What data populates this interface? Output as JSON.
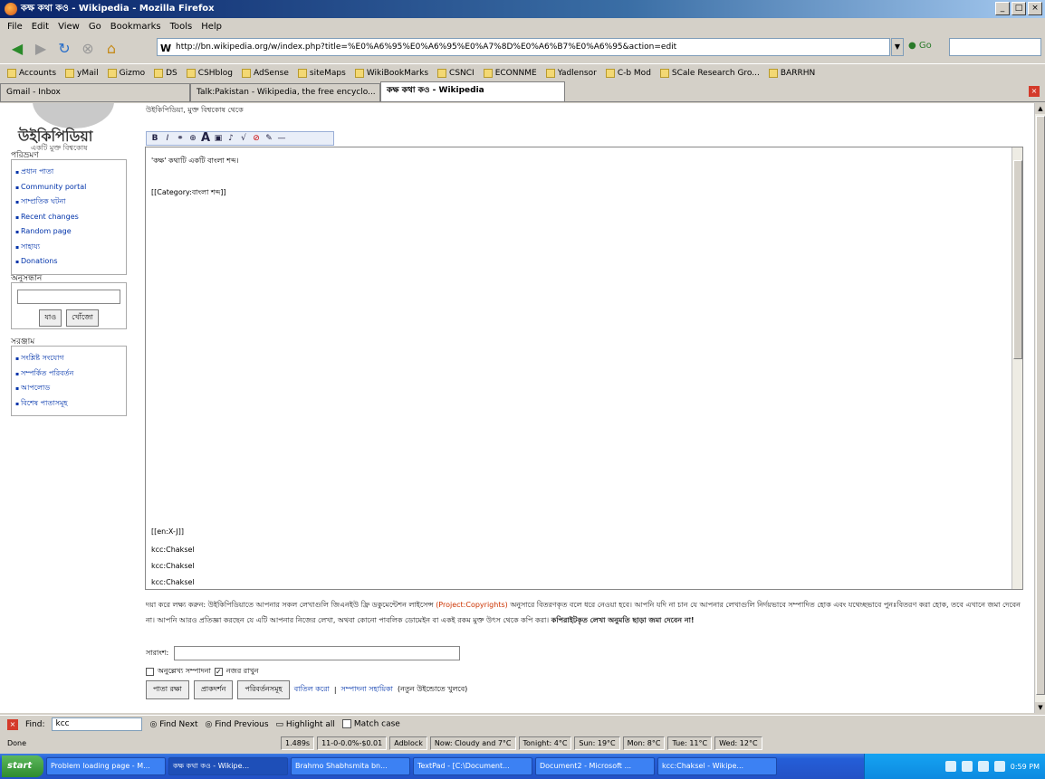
{
  "window": {
    "title": "কক্ষ কথা কও - Wikipedia - Mozilla Firefox",
    "controls": [
      "_",
      "□",
      "×"
    ]
  },
  "menubar": [
    "File",
    "Edit",
    "View",
    "Go",
    "Bookmarks",
    "Tools",
    "Help"
  ],
  "navigation": {
    "url": "http://bn.wikipedia.org/w/index.php?title=%E0%A6%95%E0%A6%95%E0%A7%8D%E0%A6%B7%E0%A6%95&action=edit",
    "go_label": "Go"
  },
  "bookmarks": [
    "Accounts",
    "yMail",
    "Gizmo",
    "DS",
    "CSHblog",
    "AdSense",
    "siteMaps",
    "WikiBookMarks",
    "CSNCI",
    "ECONNME",
    "Yadlensor",
    "C-b Mod",
    "SCale Research Gro...",
    "BARRHN"
  ],
  "tabs": [
    {
      "label": "Gmail - Inbox",
      "active": false
    },
    {
      "label": "Talk:Pakistan - Wikipedia, the free encyclo...",
      "active": false
    },
    {
      "label": "কক্ষ কথা কও - Wikipedia",
      "active": true
    }
  ],
  "sidebar": {
    "logo_title": "উইকিপিডিয়া",
    "logo_subtitle": "একটি মুক্ত বিশ্বকোষ",
    "nav_heading": "পরিভ্রমণ",
    "nav_items": [
      "প্রধান পাতা",
      "Community portal",
      "সাম্প্রতিক ঘটনা",
      "Recent changes",
      "Random page",
      "সাহায্য",
      "Donations"
    ],
    "search_heading": "অনুসন্ধান",
    "search_buttons": [
      "যাও",
      "খোঁজো"
    ],
    "toolbox_heading": "সরঞ্জাম",
    "toolbox_items": [
      "সংশ্লিষ্ট সংযোগ",
      "সম্পর্কিত পরিবর্তন",
      "আপলোড",
      "বিশেষ পাতাসমূহ"
    ]
  },
  "edit": {
    "note": "উইকিপিডিয়া, মুক্ত বিশ্বকোষ থেকে",
    "line1": "'কক্ষ' কথাটি একটি বাংলা শব্দ।",
    "line2": "[[Category:বাংলা শব্দ]]",
    "line3": "[[en:X-J]]",
    "line4": "kcc:Chaksel",
    "line5": "kcc:Chaksel",
    "line6": "kcc:Chaksel"
  },
  "copyright": {
    "text_a": "দয়া করে লক্ষ্য করুন: উইকিপিডিয়াতে আপনার সকল লেখাগুলি জিএনইউ ফ্রি ডকুমেন্টেশন লাইসেন্স",
    "link": "(Project:Copyrights)",
    "text_b": "অনুসারে বিতরণকৃত বলে ধরে নেওয়া হবে। আপনি যদি না চান যে আপনার লেখাগুলি নির্দয়ভাবে সম্পাদিত হোক এবং যথেচ্ছভাবে পুনঃবিতরণ করা হোক, তবে এখানে জমা দেবেন না।",
    "text_c": "আপনি আরও প্রতিজ্ঞা করছেন যে এটি আপনার নিজের লেখা, অথবা কোনো পাবলিক ডোমেইন বা একই রকম মুক্ত উৎস থেকে কপি করা।",
    "text_bold": "কপিরাইটকৃত লেখা অনুমতি ছাড়া জমা দেবেন না!"
  },
  "summary_label": "সারাংশ:",
  "checkboxes": [
    {
      "label": "অনুল্লেখ্য সম্পাদনা",
      "checked": false
    },
    {
      "label": "নজর রাখুন",
      "checked": true
    }
  ],
  "actions": {
    "save": "পাতা রক্ষা",
    "preview": "প্রাকদর্শন",
    "diff": "পরিবর্তনসমূহ",
    "cancel": "বাতিল করো",
    "help": "সম্পাদনা সহায়িকা",
    "new_window": "(নতুন উইন্ডোতে খুলবে)"
  },
  "findbar": {
    "label": "Find:",
    "value": "kcc",
    "next": "Find Next",
    "previous": "Find Previous",
    "highlight": "Highlight all",
    "match_case": "Match case"
  },
  "status": {
    "done": "Done",
    "cells": [
      "1.489s",
      "11-0-0.0%-$0.01",
      "Adblock",
      "Now: Cloudy and 7°C",
      "Tonight: 4°C",
      "Sun: 19°C",
      "Mon: 8°C",
      "Tue: 11°C",
      "Wed: 12°C"
    ]
  },
  "taskbar": {
    "start": "start",
    "tasks": [
      "Problem loading page - M...",
      "কক্ষ কথা কও - Wikipe...",
      "Brahmo Shabhsmita bn...",
      "TextPad - [C:\\Document...",
      "Document2 - Microsoft ...",
      "kcc:Chaksel - Wikipe..."
    ],
    "clock": "0:59 PM"
  }
}
